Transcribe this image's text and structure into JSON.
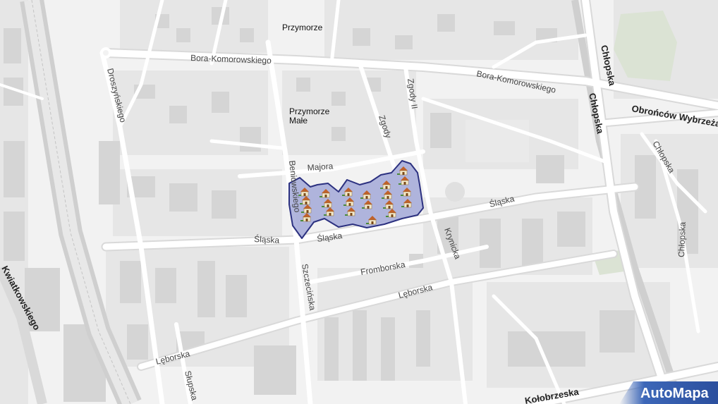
{
  "map": {
    "colors": {
      "background": "#f2f2f2",
      "block": "#e4e4e4",
      "building": "#d6d6d6",
      "road": "#ffffff",
      "road_casing": "#dcdcdc",
      "railway": "#cfcfcf",
      "green": "#dbe3d4",
      "area_fill": "#a3a9d8",
      "area_stroke": "#2c3180"
    },
    "place_labels": {
      "przymorze": "Przymorze",
      "przymorze_male_1": "Przymorze",
      "przymorze_male_2": "Małe"
    },
    "street_labels": {
      "bora_1": "Bora-Komorowskiego",
      "bora_2": "Bora-Komorowskiego",
      "chlopska_top": "Chłopska",
      "chlopska_main": "Chłopska",
      "chlopska_right": "Chłopska",
      "chlopska_far": "Chłopska",
      "obroncow": "Obrońców Wybrzeża",
      "droszynskiego": "Droszyńskiego",
      "zgody_ii": "Zgody II",
      "zgody": "Zgody",
      "majora": "Majora",
      "beniowskiego": "Beniowskiego",
      "slaska_1": "Śląska",
      "slaska_2": "Śląska",
      "slaska_3": "Śląska",
      "krynicka": "Krynicka",
      "fromborska": "Fromborska",
      "leborska_1": "Lęborska",
      "leborska_2": "Lęborska",
      "szczecinska": "Szczecińska",
      "slupska": "Słupska",
      "kwiatkowskiego": "Kwiatkowskiego",
      "jelitkowska": "Kołobrzeska"
    },
    "icons": {
      "house": "house-icon"
    },
    "branding": {
      "name": "AutoMapa"
    }
  }
}
